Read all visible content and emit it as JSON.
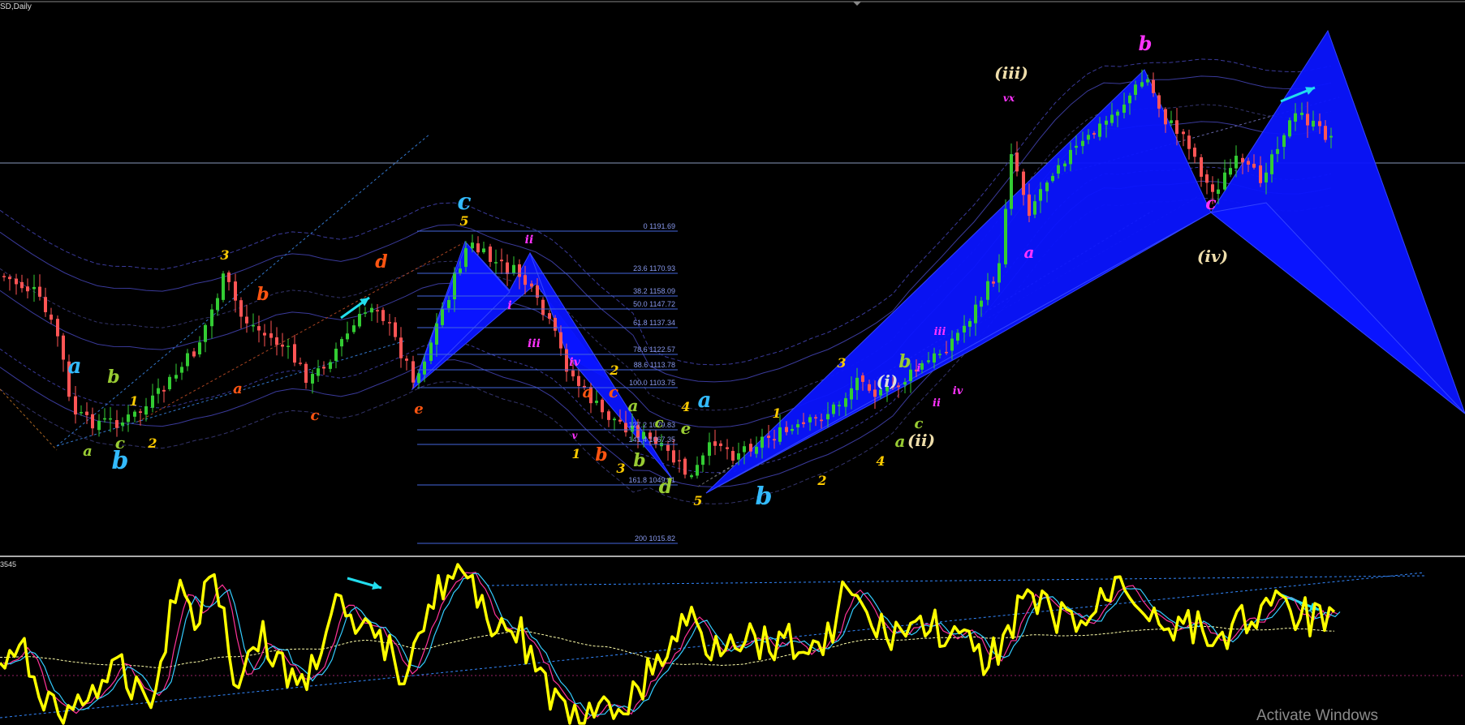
{
  "window": {
    "symbol_label": "SD,Daily",
    "osc_label": "3545",
    "watermark": "Activate Windows"
  },
  "colors": {
    "bg": "#000000",
    "bull": "#33cc33",
    "bear": "#ff5555",
    "pattern": "#0a14ff",
    "osc_main": "#ffff00",
    "osc_fast": "#ff3399",
    "osc_slow": "#33ccff",
    "arrow": "#22ddee"
  },
  "chart_data": {
    "type": "candlestick",
    "fib_levels": [
      {
        "pct": "0",
        "price": "1191.69"
      },
      {
        "pct": "23.6",
        "price": "1170.93"
      },
      {
        "pct": "38.2",
        "price": "1158.09"
      },
      {
        "pct": "50.0",
        "price": "1147.72"
      },
      {
        "pct": "61.8",
        "price": "1137.34"
      },
      {
        "pct": "78.6",
        "price": "1122.57"
      },
      {
        "pct": "88.6",
        "price": "1113.78"
      },
      {
        "pct": "100.0",
        "price": "1103.75"
      },
      {
        "pct": "127.2",
        "price": "1079.83"
      },
      {
        "pct": "141.4",
        "price": "1067.35"
      },
      {
        "pct": "161.8",
        "price": "1049.41"
      },
      {
        "pct": "200",
        "price": "1015.82"
      }
    ],
    "wave_labels": [
      {
        "t": "a",
        "c": "#33bbff",
        "s": 26
      },
      {
        "t": "b",
        "c": "#99cc33",
        "s": 22
      },
      {
        "t": "1",
        "c": "#ffcc00",
        "s": 16
      },
      {
        "t": "a",
        "c": "#99cc33",
        "s": 18
      },
      {
        "t": "c",
        "c": "#99cc33",
        "s": 20
      },
      {
        "t": "b",
        "c": "#33bbff",
        "s": 30
      },
      {
        "t": "2",
        "c": "#ffcc00",
        "s": 16
      },
      {
        "t": "3",
        "c": "#ffcc00",
        "s": 16
      },
      {
        "t": "b",
        "c": "#ff5511",
        "s": 22
      },
      {
        "t": "a",
        "c": "#ff5511",
        "s": 18
      },
      {
        "t": "c",
        "c": "#ff5511",
        "s": 18
      },
      {
        "t": "d",
        "c": "#ff5511",
        "s": 22
      },
      {
        "t": "e",
        "c": "#ff5511",
        "s": 18
      },
      {
        "t": "c",
        "c": "#33bbff",
        "s": 28
      },
      {
        "t": "5",
        "c": "#ffcc00",
        "s": 16
      },
      {
        "t": "ii",
        "c": "#ff33ff",
        "s": 14
      },
      {
        "t": "i",
        "c": "#ff33ff",
        "s": 14
      },
      {
        "t": "iii",
        "c": "#ff33ff",
        "s": 14
      },
      {
        "t": "iv",
        "c": "#ff33ff",
        "s": 14
      },
      {
        "t": "v",
        "c": "#ff33ff",
        "s": 12
      },
      {
        "t": "2",
        "c": "#ffcc00",
        "s": 16
      },
      {
        "t": "a",
        "c": "#ff5511",
        "s": 20
      },
      {
        "t": "c",
        "c": "#ff5511",
        "s": 20
      },
      {
        "t": "1",
        "c": "#ffcc00",
        "s": 16
      },
      {
        "t": "b",
        "c": "#ff5511",
        "s": 22
      },
      {
        "t": "3",
        "c": "#ffcc00",
        "s": 16
      },
      {
        "t": "a",
        "c": "#99cc33",
        "s": 20
      },
      {
        "t": "b",
        "c": "#99cc33",
        "s": 22
      },
      {
        "t": "c",
        "c": "#99cc33",
        "s": 18
      },
      {
        "t": "e",
        "c": "#99cc33",
        "s": 20
      },
      {
        "t": "d",
        "c": "#99cc33",
        "s": 24
      },
      {
        "t": "4",
        "c": "#ffcc00",
        "s": 16
      },
      {
        "t": "a",
        "c": "#33bbff",
        "s": 26
      },
      {
        "t": "5",
        "c": "#ffcc00",
        "s": 16
      },
      {
        "t": "1",
        "c": "#ffcc00",
        "s": 16
      },
      {
        "t": "b",
        "c": "#33bbff",
        "s": 30
      },
      {
        "t": "2",
        "c": "#ffcc00",
        "s": 16
      },
      {
        "t": "3",
        "c": "#ffcc00",
        "s": 16
      },
      {
        "t": "(i)",
        "c": "#dddddd",
        "s": 20
      },
      {
        "t": "4",
        "c": "#ffcc00",
        "s": 16
      },
      {
        "t": "b",
        "c": "#99cc33",
        "s": 22
      },
      {
        "t": "c",
        "c": "#99cc33",
        "s": 18
      },
      {
        "t": "a",
        "c": "#99cc33",
        "s": 20
      },
      {
        "t": "(ii)",
        "c": "#eeddaa",
        "s": 20
      },
      {
        "t": "i",
        "c": "#ff33ff",
        "s": 13
      },
      {
        "t": "iii",
        "c": "#ff33ff",
        "s": 13
      },
      {
        "t": "ii",
        "c": "#ff33ff",
        "s": 13
      },
      {
        "t": "iv",
        "c": "#ff33ff",
        "s": 13
      },
      {
        "t": "(iii)",
        "c": "#eeddaa",
        "s": 20
      },
      {
        "t": "vx",
        "c": "#ff33ff",
        "s": 12
      },
      {
        "t": "a",
        "c": "#ff33ff",
        "s": 20
      },
      {
        "t": "b",
        "c": "#ff33ff",
        "s": 24
      },
      {
        "t": "c",
        "c": "#ff33ff",
        "s": 22
      },
      {
        "t": "(iv)",
        "c": "#eeddaa",
        "s": 20
      }
    ]
  }
}
